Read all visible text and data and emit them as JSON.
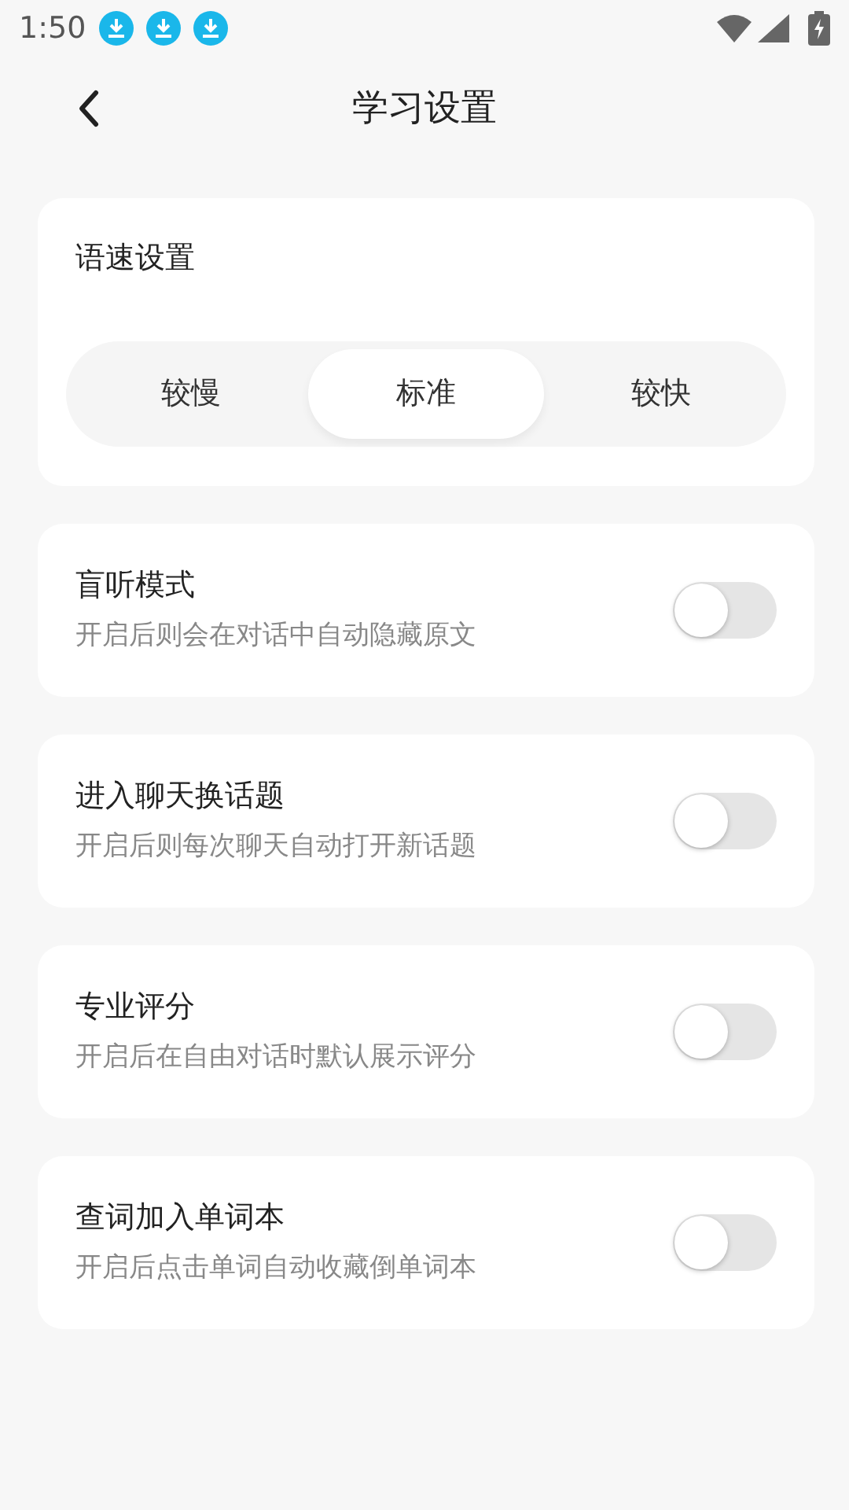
{
  "status_bar": {
    "time": "1:50"
  },
  "header": {
    "title": "学习设置"
  },
  "speed": {
    "title": "语速设置",
    "options": [
      {
        "label": "较慢",
        "selected": false
      },
      {
        "label": "标准",
        "selected": true
      },
      {
        "label": "较快",
        "selected": false
      }
    ]
  },
  "settings": [
    {
      "title": "盲听模式",
      "description": "开启后则会在对话中自动隐藏原文",
      "on": false
    },
    {
      "title": "进入聊天换话题",
      "description": "开启后则每次聊天自动打开新话题",
      "on": false
    },
    {
      "title": "专业评分",
      "description": "开启后在自由对话时默认展示评分",
      "on": false
    },
    {
      "title": "查词加入单词本",
      "description": "开启后点击单词自动收藏倒单词本",
      "on": false
    }
  ]
}
